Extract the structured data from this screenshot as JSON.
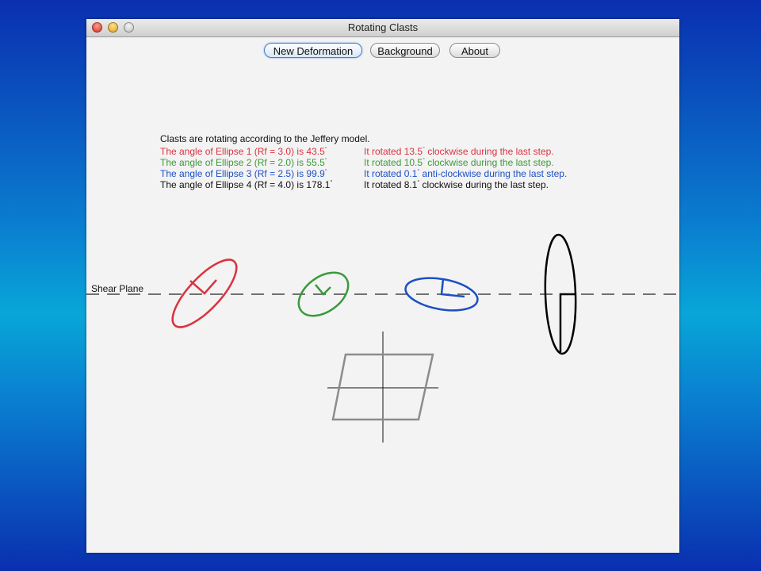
{
  "window": {
    "title": "Rotating Clasts"
  },
  "toolbar": {
    "new_deformation": "New Deformation",
    "background": "Background",
    "about": "About"
  },
  "info": {
    "header": "Clasts are rotating according to the Jeffery model.",
    "lines": [
      {
        "angle_prefix": "The angle of Ellipse 1 (Rf = 3.0) is 43.5",
        "rotation_prefix": "It rotated 13.5",
        "rotation_suffix": " clockwise during the last step.",
        "color": "#d9333f"
      },
      {
        "angle_prefix": "The angle of Ellipse 2 (Rf = 2.0) is 55.5",
        "rotation_prefix": "It rotated 10.5",
        "rotation_suffix": " clockwise during the last step.",
        "color": "#3a9a3a"
      },
      {
        "angle_prefix": "The angle of Ellipse 3 (Rf = 2.5) is 99.9",
        "rotation_prefix": "It rotated 0.1",
        "rotation_suffix": " anti-clockwise during the last step.",
        "color": "#1c4fc4"
      },
      {
        "angle_prefix": "The angle of Ellipse 4 (Rf = 4.0) is 178.1",
        "rotation_prefix": "It rotated 8.1",
        "rotation_suffix": " clockwise during the last step.",
        "color": "#111111"
      }
    ],
    "degree_symbol": "°"
  },
  "shear_plane_label": "Shear Plane",
  "colors": {
    "ellipse1": "#d9333f",
    "ellipse2": "#3a9a3a",
    "ellipse3": "#1c4fc4",
    "ellipse4": "#000000",
    "grid": "#8c8c8c"
  }
}
